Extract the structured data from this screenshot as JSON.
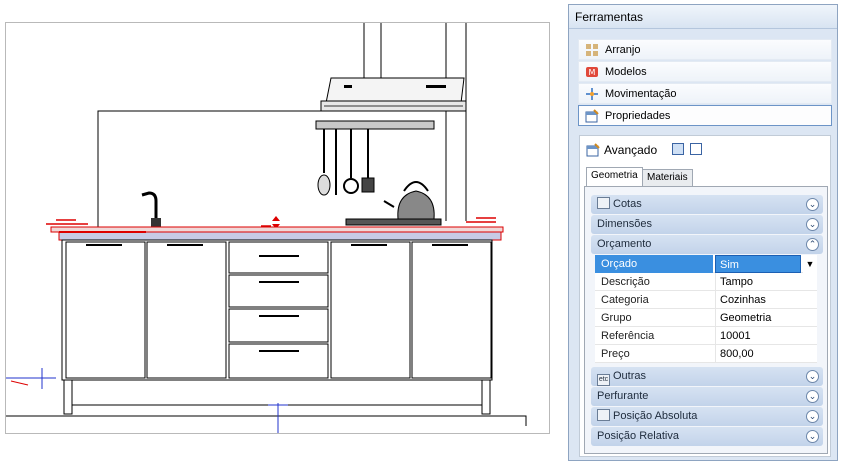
{
  "panel": {
    "title": "Ferramentas"
  },
  "nav": [
    {
      "label": "Arranjo",
      "icon": "arrangement-icon"
    },
    {
      "label": "Modelos",
      "icon": "models-icon"
    },
    {
      "label": "Movimentação",
      "icon": "move-icon"
    },
    {
      "label": "Propriedades",
      "icon": "properties-icon",
      "active": true
    }
  ],
  "advanced": {
    "label": "Avançado"
  },
  "tabs": {
    "geometria": "Geometria",
    "materiais": "Materiais"
  },
  "sections": {
    "cotas": "Cotas",
    "dimensoes": "Dimensões",
    "orcamento": "Orçamento",
    "outras": "Outras",
    "perfurante": "Perfurante",
    "posicao_absoluta": "Posição Absoluta",
    "posicao_relativa": "Posição Relativa"
  },
  "properties": [
    {
      "name": "Orçado",
      "value": "Sim"
    },
    {
      "name": "Descrição",
      "value": "Tampo"
    },
    {
      "name": "Categoria",
      "value": "Cozinhas"
    },
    {
      "name": "Grupo",
      "value": "Geometria"
    },
    {
      "name": "Referência",
      "value": "10001"
    },
    {
      "name": "Preço",
      "value": "800,00"
    }
  ],
  "icon_labels": {
    "etc": "etc"
  }
}
